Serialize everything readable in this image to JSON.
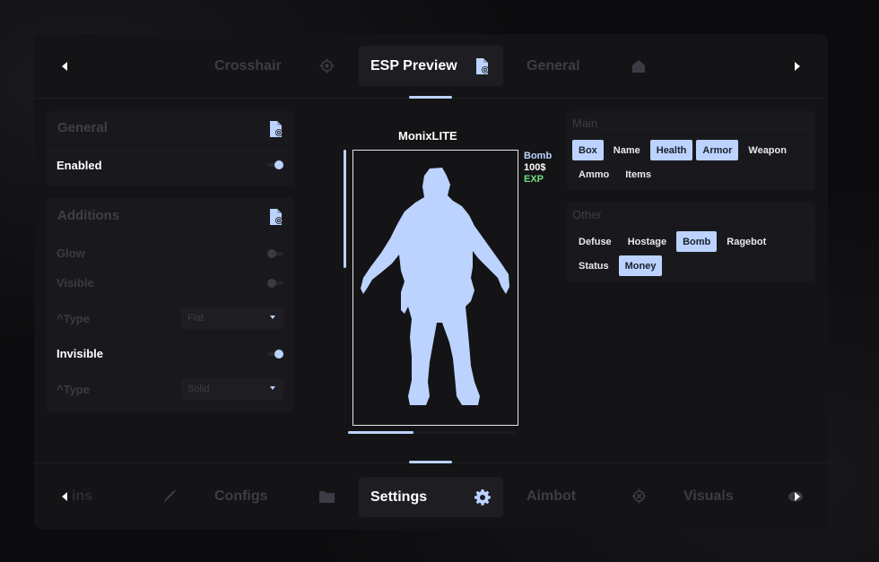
{
  "top_nav": {
    "items": [
      {
        "label": "Crosshair",
        "icon": "crosshair-icon"
      },
      {
        "label": "ESP Preview",
        "icon": "file-eye-icon"
      },
      {
        "label": "General",
        "icon": "home-icon"
      }
    ]
  },
  "bottom_nav": {
    "items": [
      {
        "label": "ins",
        "icon": "knife-icon"
      },
      {
        "label": "Configs",
        "icon": "folder-icon"
      },
      {
        "label": "Settings",
        "icon": "gear-icon"
      },
      {
        "label": "Aimbot",
        "icon": "crosshair-icon"
      },
      {
        "label": "Visuals",
        "icon": "eye-icon"
      }
    ]
  },
  "general_card": {
    "title": "General",
    "enabled_label": "Enabled"
  },
  "additions_card": {
    "title": "Additions",
    "glow_label": "Glow",
    "visible_label": "Visible",
    "type1_label": "^Type",
    "type1_value": "Flat",
    "invisible_label": "Invisible",
    "type2_label": "^Type",
    "type2_value": "Solid"
  },
  "preview": {
    "name": "MonixLITE",
    "flag_bomb": "Bomb",
    "flag_money": "100$",
    "flag_exp": "EXP",
    "health_fraction": 0.43,
    "ammo_fraction": 0.39
  },
  "main_group": {
    "title": "Main",
    "chips": [
      {
        "label": "Box",
        "active": true
      },
      {
        "label": "Name",
        "active": false
      },
      {
        "label": "Health",
        "active": true
      },
      {
        "label": "Armor",
        "active": true
      },
      {
        "label": "Weapon",
        "active": false
      },
      {
        "label": "Ammo",
        "active": false
      },
      {
        "label": "Items",
        "active": false
      }
    ]
  },
  "other_group": {
    "title": "Other",
    "chips": [
      {
        "label": "Defuse",
        "active": false
      },
      {
        "label": "Hostage",
        "active": false
      },
      {
        "label": "Bomb",
        "active": true
      },
      {
        "label": "Ragebot",
        "active": false
      },
      {
        "label": "Status",
        "active": false
      },
      {
        "label": "Money",
        "active": true
      }
    ]
  },
  "colors": {
    "accent": "#bcd3ff",
    "panel": "#141417",
    "card": "#19191d",
    "exp_flag": "#6fe07f"
  }
}
